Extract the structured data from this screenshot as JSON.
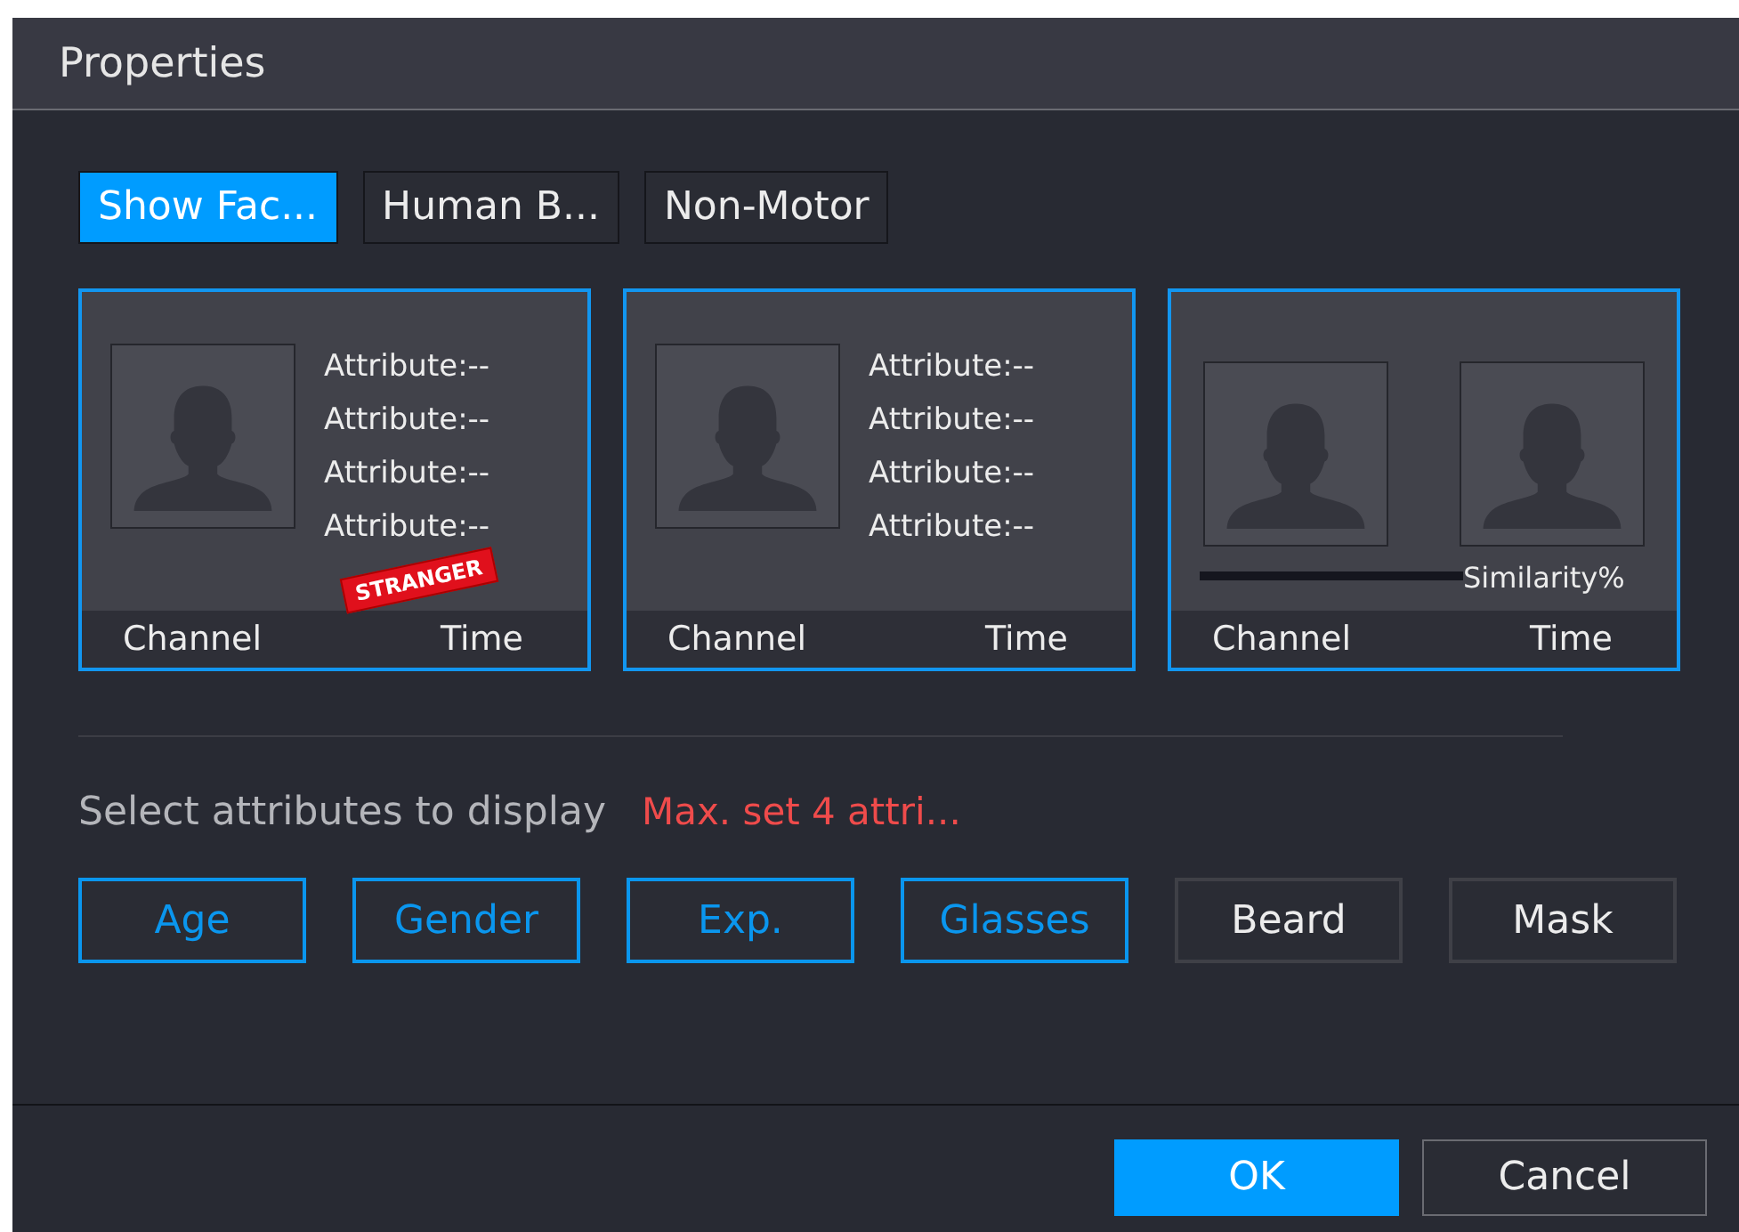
{
  "window": {
    "title": "Properties"
  },
  "tabs": [
    {
      "label": "Show Fac...",
      "selected": true
    },
    {
      "label": "Human B...",
      "selected": false
    },
    {
      "label": "Non-Motor",
      "selected": false
    }
  ],
  "cards": [
    {
      "kind": "attributes",
      "attributes": [
        "Attribute:--",
        "Attribute:--",
        "Attribute:--",
        "Attribute:--"
      ],
      "stamp": "STRANGER",
      "channel": "Channel",
      "time": "Time"
    },
    {
      "kind": "attributes",
      "attributes": [
        "Attribute:--",
        "Attribute:--",
        "Attribute:--",
        "Attribute:--"
      ],
      "channel": "Channel",
      "time": "Time"
    },
    {
      "kind": "compare",
      "similarity": "Similarity%",
      "channel": "Channel",
      "time": "Time"
    }
  ],
  "attributes_label": "Select attributes to display",
  "attributes_hint": "Max. set 4 attri...",
  "attribute_buttons": [
    {
      "label": "Age",
      "selected": true
    },
    {
      "label": "Gender",
      "selected": true
    },
    {
      "label": "Exp.",
      "selected": true
    },
    {
      "label": "Glasses",
      "selected": true
    },
    {
      "label": "Beard",
      "selected": false
    },
    {
      "label": "Mask",
      "selected": false
    }
  ],
  "buttons": [
    {
      "label": "OK",
      "kind": "primary"
    },
    {
      "label": "Cancel",
      "kind": "secondary"
    }
  ]
}
